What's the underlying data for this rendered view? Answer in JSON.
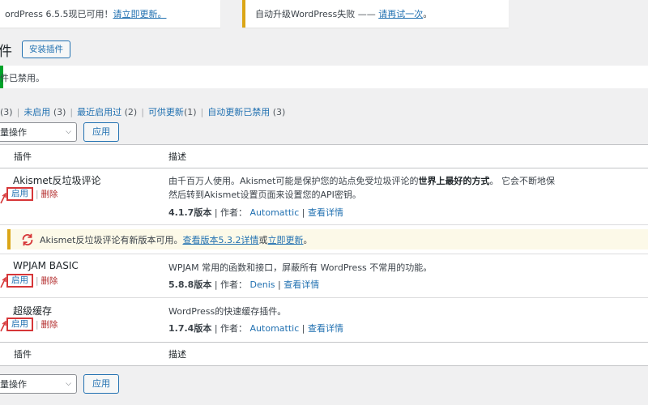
{
  "notices": {
    "update": {
      "text": "ordPress 6.5.5现已可用！",
      "link": "请立即更新。"
    },
    "auto": {
      "text": "自动升级WordPress失败 —— ",
      "link": "请再试一次",
      "suffix": "。"
    }
  },
  "header": {
    "title": "件",
    "install_button": "安装插件"
  },
  "message": "件已禁用。",
  "filters": [
    {
      "label": "",
      "count": "(3)"
    },
    {
      "label": "未启用",
      "count": "(3)"
    },
    {
      "label": "最近启用过",
      "count": "(2)"
    },
    {
      "label": "可供更新",
      "count": "(1)"
    },
    {
      "label": "自动更新已禁用",
      "count": "(3)"
    }
  ],
  "bulk": {
    "select_value": "量操作",
    "apply_label": "应用"
  },
  "columns": {
    "plugin": "插件",
    "description": "描述"
  },
  "actions": {
    "activate": "启用",
    "delete": "删除",
    "sep": "|"
  },
  "plugins": [
    {
      "name": "Akismet反垃圾评论",
      "desc_line1_pre": "由千百万人使用。Akismet可能是保护您的站点免受垃圾评论的",
      "desc_line1_bold": "世界上最好的方式",
      "desc_line1_post": "。 它会不断地保",
      "desc_line2": "然后转到Akismet设置页面来设置您的API密钥。",
      "version": "4.1.7版本",
      "author_label": "作者：",
      "author": "Automattic",
      "details": "查看详情"
    },
    {
      "name": "WPJAM BASIC",
      "desc_line1_pre": "WPJAM 常用的函数和接口，屏蔽所有 WordPress 不常用的功能。",
      "desc_line1_bold": "",
      "desc_line1_post": "",
      "desc_line2": "",
      "version": "5.8.8版本",
      "author_label": "作者：",
      "author": "Denis",
      "details": "查看详情"
    },
    {
      "name": "超级缓存",
      "desc_line1_pre": "WordPress的快速缓存插件。",
      "desc_line1_bold": "",
      "desc_line1_post": "",
      "desc_line2": "",
      "version": "1.7.4版本",
      "author_label": "作者：",
      "author": "Automattic",
      "details": "查看详情"
    }
  ],
  "update_notice": {
    "text": "Akismet反垃圾评论有新版本可用。",
    "link1": "查看版本5.3.2详情",
    "or": "或",
    "link2": "立即更新",
    "suffix": "。"
  },
  "colors": {
    "accent": "#2271b1",
    "warning": "#dba617",
    "success": "#00a32a",
    "danger": "#d63638"
  },
  "icons": {
    "update": "update-refresh-icon",
    "arrow": "red-arrow-pointer"
  }
}
